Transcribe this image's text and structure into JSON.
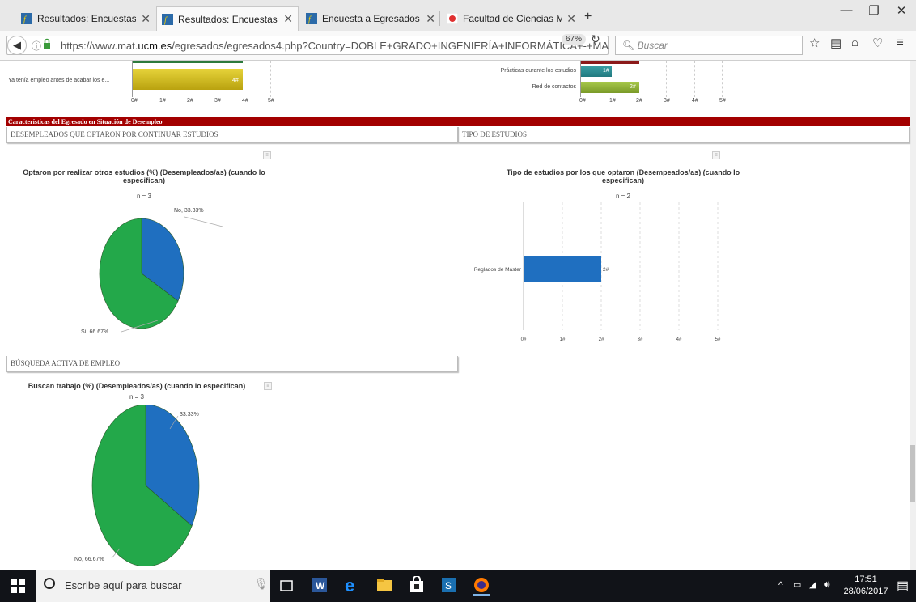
{
  "browser": {
    "tabs": [
      {
        "label": "Resultados: Encuestas a egr",
        "active": false
      },
      {
        "label": "Resultados: Encuestas a egr",
        "active": true
      },
      {
        "label": "Encuesta a Egresados de la F",
        "active": false
      },
      {
        "label": "Facultad de Ciencias Matem",
        "active": false
      }
    ],
    "new_tab": "+",
    "url_prefix": "https://www.mat.",
    "url_domain": "ucm.es",
    "url_rest": "/egresados/egresados4.php?Country=DOBLE+GRADO+INGENIERÍA+INFORMÁTICA+-+MA",
    "zoom": "67%",
    "search_placeholder": "Buscar"
  },
  "top_left_chart": {
    "row_label": "Ya tenía empleo antes de acabar los e...",
    "bar_value": 4,
    "bar_value_label": "4#",
    "ticks": [
      "0#",
      "1#",
      "2#",
      "3#",
      "4#",
      "5#"
    ]
  },
  "top_right_chart": {
    "rows": [
      {
        "label": "Prácticas durante los estudios",
        "value": 1,
        "value_label": "1#"
      },
      {
        "label": "Red de contactos",
        "value": 2,
        "value_label": "2#"
      }
    ],
    "ticks": [
      "0#",
      "1#",
      "2#",
      "3#",
      "4#",
      "5#"
    ]
  },
  "section_header": "Características del Egresado en Situación de Desempleo",
  "subsections": {
    "continuar": "DESEMPLEADOS QUE OPTARON POR CONTINUAR ESTUDIOS",
    "tipo": "TIPO DE ESTUDIOS",
    "busqueda": "BÚSQUEDA ACTIVA DE EMPLEO"
  },
  "chart_data": [
    {
      "type": "pie",
      "title": "Optaron por realizar otros estudios (%) (Desempleados/as) (cuando lo especifican)",
      "subtitle": "n = 3",
      "slices": [
        {
          "label": "No",
          "value": 33.33,
          "data_label": "No, 33.33%",
          "color": "#1f6fc0"
        },
        {
          "label": "Sí",
          "value": 66.67,
          "data_label": "Sí, 66.67%",
          "color": "#23a84a"
        }
      ]
    },
    {
      "type": "bar",
      "orientation": "horizontal",
      "title": "Tipo de estudios por los que optaron (Desempeados/as) (cuando lo especifican)",
      "subtitle": "n = 2",
      "categories": [
        "Reglados de Máster"
      ],
      "values": [
        2
      ],
      "value_labels": [
        "2#"
      ],
      "xlim": [
        0,
        5
      ],
      "ticks": [
        "0#",
        "1#",
        "2#",
        "3#",
        "4#",
        "5#"
      ],
      "color": "#1f6fc0"
    },
    {
      "type": "pie",
      "title": "Buscan trabajo (%) (Desempleados/as) (cuando lo especifican)",
      "subtitle": "n = 3",
      "slices": [
        {
          "label": "",
          "value": 33.33,
          "data_label": "33.33%",
          "color": "#1f6fc0"
        },
        {
          "label": "No",
          "value": 66.67,
          "data_label": "No, 66.67%",
          "color": "#23a84a"
        }
      ]
    }
  ],
  "taskbar": {
    "search_placeholder": "Escribe aquí para buscar",
    "time": "17:51",
    "date": "28/06/2017"
  },
  "colors": {
    "section_red": "#a30000",
    "blue": "#1f6fc0",
    "green": "#23a84a",
    "olive": "#c7b11a"
  }
}
